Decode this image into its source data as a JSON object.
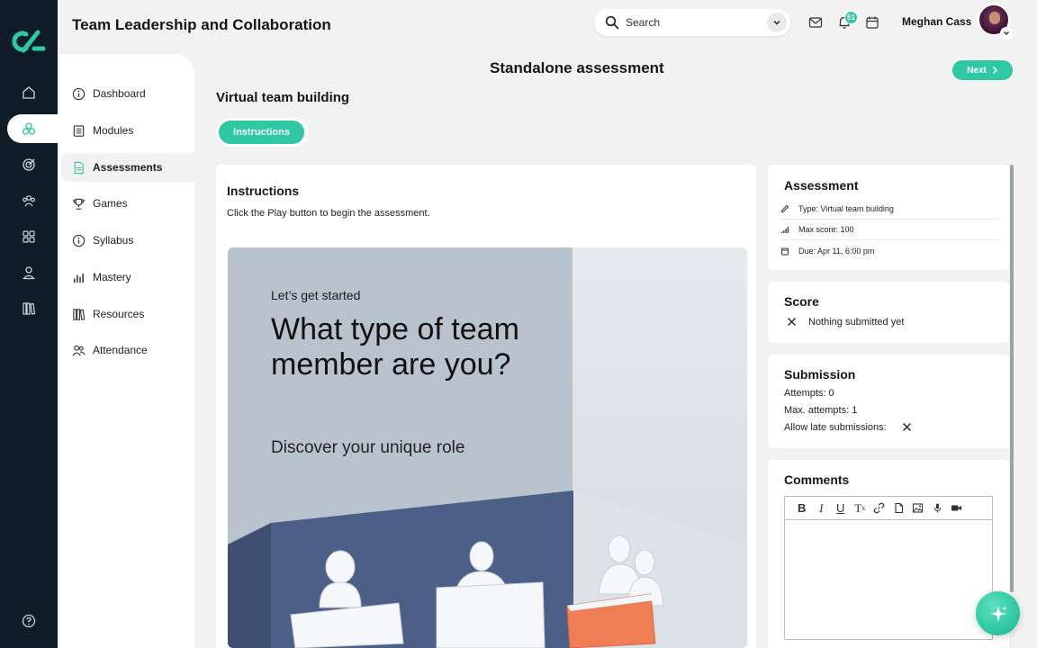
{
  "header": {
    "course_title": "Team Leadership and Collaboration",
    "search_placeholder": "Search",
    "notification_count": "51",
    "user_name": "Meghan Cass"
  },
  "sidebar": {
    "items": [
      {
        "label": "Dashboard",
        "icon": "info-circle-icon"
      },
      {
        "label": "Modules",
        "icon": "list-icon"
      },
      {
        "label": "Assessments",
        "icon": "document-icon",
        "active": true
      },
      {
        "label": "Games",
        "icon": "trophy-icon"
      },
      {
        "label": "Syllabus",
        "icon": "info-circle-icon"
      },
      {
        "label": "Mastery",
        "icon": "bar-chart-icon"
      },
      {
        "label": "Resources",
        "icon": "books-icon"
      },
      {
        "label": "Attendance",
        "icon": "people-icon"
      }
    ]
  },
  "main": {
    "page_heading": "Standalone assessment",
    "next_label": "Next",
    "sub_title": "Virtual team building",
    "tab_label": "Instructions",
    "instructions_title": "Instructions",
    "instructions_text": "Click the Play button to begin the assessment.",
    "hero": {
      "kicker": "Let’s get started",
      "headline": "What type of team member are you?",
      "tagline": "Discover your unique role"
    }
  },
  "assessment_card": {
    "title": "Assessment",
    "type": "Type: Virtual team building",
    "max_score": "Max score: 100",
    "due": "Due: Apr 11, 6:00 pm"
  },
  "score_card": {
    "title": "Score",
    "status": "Nothing submitted yet"
  },
  "submission_card": {
    "title": "Submission",
    "attempts": "Attempts: 0",
    "max_attempts": "Max. attempts: 1",
    "late": "Allow late submissions:"
  },
  "comments_card": {
    "title": "Comments",
    "toolbar": [
      "bold",
      "italic",
      "underline",
      "clear-format",
      "link",
      "file",
      "image",
      "audio",
      "video"
    ]
  },
  "colors": {
    "accent": "#2ec9a2",
    "rail": "#0f1b26"
  }
}
